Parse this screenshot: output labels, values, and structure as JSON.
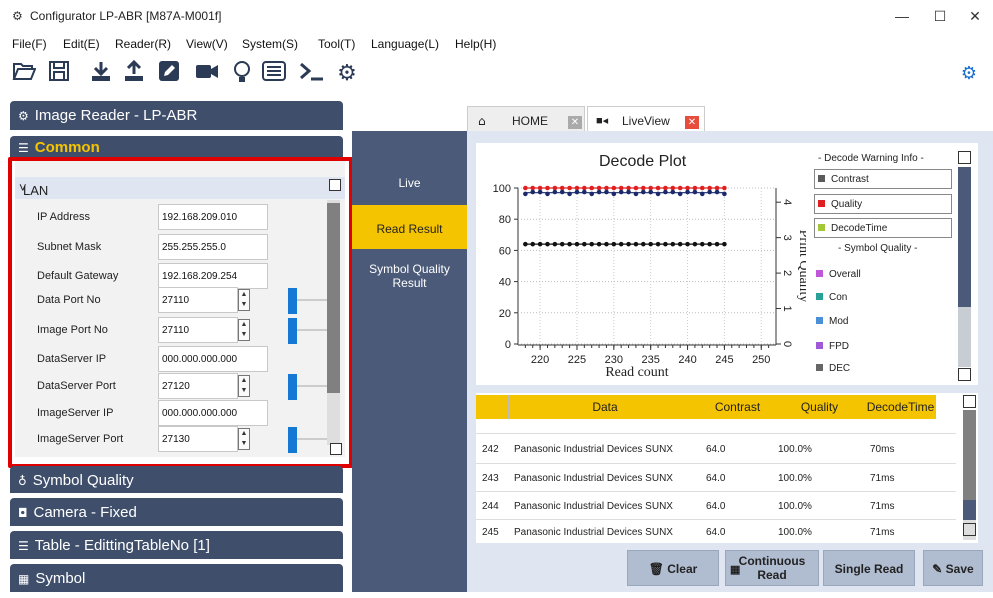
{
  "window": {
    "title": "Configurator LP-ABR [M87A-M001f]",
    "min": "—",
    "max": "☐",
    "close": "✕"
  },
  "menu": [
    "File(F)",
    "Edit(E)",
    "Reader(R)",
    "View(V)",
    "System(S)",
    "Tool(T)",
    "Language(L)",
    "Help(H)"
  ],
  "toolbar_icons": [
    "open-folder-icon",
    "save-disk-icon",
    "download-icon",
    "upload-icon",
    "edit-icon",
    "camera-icon",
    "lightbulb-icon",
    "list-icon",
    "terminal-icon",
    "gear-icon",
    "settings-gears-icon"
  ],
  "left": {
    "reader": "Image Reader - LP-ABR",
    "common": "Common",
    "lan": "LAN",
    "fields": [
      {
        "label": "IP Address",
        "value": "192.168.209.010"
      },
      {
        "label": "Subnet Mask",
        "value": "255.255.255.0"
      },
      {
        "label": "Default Gateway",
        "value": "192.168.209.254"
      },
      {
        "label": "Data Port No",
        "value": "27110"
      },
      {
        "label": "Image Port No",
        "value": "27110"
      },
      {
        "label": "DataServer IP",
        "value": "000.000.000.000"
      },
      {
        "label": "DataServer Port",
        "value": "27120"
      },
      {
        "label": "ImageServer IP",
        "value": "000.000.000.000"
      },
      {
        "label": "ImageServer Port",
        "value": "27130"
      }
    ],
    "symbol_quality": "Symbol Quality",
    "camera": "Camera - Fixed",
    "table": "Table - EdittingTableNo [1]",
    "symbol": "Symbol"
  },
  "nav": {
    "live": "Live",
    "read_result": "Read Result",
    "symbol_quality_l1": "Symbol Quality",
    "symbol_quality_l2": "Result"
  },
  "tabs": {
    "home": "HOME",
    "liveview": "LiveView"
  },
  "plot": {
    "title": "Decode Plot",
    "legend_header": "- Decode Warning Info -",
    "legend_items": [
      {
        "name": "Contrast",
        "color": "#5a5a5a",
        "boxed": true
      },
      {
        "name": "Quality",
        "color": "#e02020",
        "boxed": true
      },
      {
        "name": "DecodeTime",
        "color": "#a4c639",
        "boxed": true
      },
      {
        "name": "- Symbol Quality -",
        "color": "",
        "boxed": false
      },
      {
        "name": "Overall",
        "color": "#c056d8",
        "boxed": false
      },
      {
        "name": "Con",
        "color": "#2aa198",
        "boxed": false
      },
      {
        "name": "Mod",
        "color": "#4a90d9",
        "boxed": false
      },
      {
        "name": "FPD",
        "color": "#a05ad8",
        "boxed": false
      },
      {
        "name": "DEC",
        "color": "#666",
        "boxed": false
      }
    ]
  },
  "chart_data": {
    "type": "scatter",
    "title": "Decode Plot",
    "xlabel": "Read count",
    "ylabel": "Print Quality",
    "xlim": [
      217,
      252
    ],
    "ylim": [
      0,
      100
    ],
    "xticks": [
      "220",
      "225",
      "230",
      "235",
      "240",
      "245",
      "250"
    ],
    "yticks": [
      "0",
      "20",
      "40",
      "60",
      "80",
      "100"
    ],
    "y2ticks": [
      "0",
      "1",
      "2",
      "3",
      "4"
    ],
    "series": [
      {
        "name": "Quality",
        "color": "#e02020",
        "y": 100
      },
      {
        "name": "",
        "color": "#1a2a6a",
        "y": 97
      },
      {
        "name": "Contrast",
        "color": "#111111",
        "y": 64
      }
    ],
    "x_points": [
      218,
      219,
      220,
      221,
      222,
      223,
      224,
      225,
      226,
      227,
      228,
      229,
      230,
      231,
      232,
      233,
      234,
      235,
      236,
      237,
      238,
      239,
      240,
      241,
      242,
      243,
      244,
      245
    ]
  },
  "table": {
    "headers": [
      "Data",
      "Contrast",
      "Quality",
      "DecodeTime"
    ],
    "rows": [
      {
        "no": "242",
        "data": "Panasonic Industrial Devices SUNX",
        "contrast": "64.0",
        "quality": "100.0%",
        "time": "70ms"
      },
      {
        "no": "243",
        "data": "Panasonic Industrial Devices SUNX",
        "contrast": "64.0",
        "quality": "100.0%",
        "time": "71ms"
      },
      {
        "no": "244",
        "data": "Panasonic Industrial Devices SUNX",
        "contrast": "64.0",
        "quality": "100.0%",
        "time": "71ms"
      },
      {
        "no": "245",
        "data": "Panasonic Industrial Devices SUNX",
        "contrast": "64.0",
        "quality": "100.0%",
        "time": "71ms"
      }
    ]
  },
  "buttons": {
    "clear": "Clear",
    "continuous_l1": "Continuous",
    "continuous_l2": "Read",
    "single": "Single Read",
    "save": "Save"
  }
}
